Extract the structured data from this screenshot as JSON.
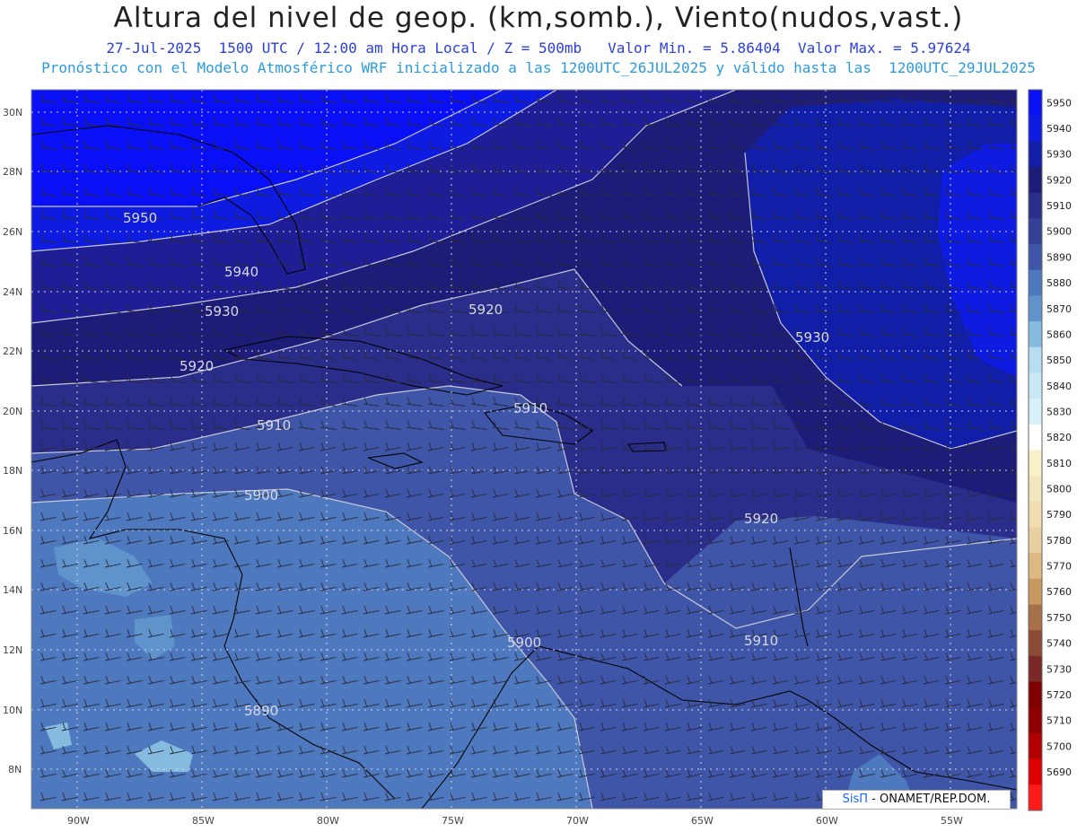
{
  "header": {
    "title": "Altura del nivel de geop. (km,somb.), Viento(nudos,vast.)",
    "line1": "27-Jul-2025  1500 UTC / 12:00 am Hora Local / Z = 500mb   Valor Min. = 5.86404  Valor Max. = 5.97624",
    "line2": "Pronóstico con el Modelo Atmosférico WRF inicializado a las 1200UTC_26JUL2025 y válido hasta las  1200UTC_29JUL2025"
  },
  "map": {
    "lat_labels": [
      "30N",
      "28N",
      "26N",
      "24N",
      "22N",
      "20N",
      "18N",
      "16N",
      "14N",
      "12N",
      "10N",
      "8N"
    ],
    "lon_labels": [
      "90W",
      "85W",
      "80W",
      "75W",
      "70W",
      "65W",
      "60W",
      "55W"
    ],
    "contour_labels": [
      "5950",
      "5940",
      "5930",
      "5920",
      "5920",
      "5930",
      "5910",
      "5910",
      "5900",
      "5920",
      "5910",
      "5900",
      "5890"
    ]
  },
  "colorbar": {
    "levels": [
      "5950",
      "5940",
      "5930",
      "5920",
      "5910",
      "5900",
      "5890",
      "5880",
      "5870",
      "5860",
      "5850",
      "5840",
      "5830",
      "5820",
      "5810",
      "5800",
      "5790",
      "5780",
      "5770",
      "5760",
      "5750",
      "5740",
      "5730",
      "5720",
      "5710",
      "5700",
      "5690"
    ],
    "colors": [
      "#0a10f5",
      "#0e1be0",
      "#101ea8",
      "#1d1c78",
      "#2b2d8a",
      "#343f96",
      "#3e55a8",
      "#4e79bf",
      "#5e93cc",
      "#86bbe0",
      "#b6def0",
      "#c8e8f5",
      "#d8f0f8",
      "#ffffff",
      "#f8f0c8",
      "#f4e6bc",
      "#efdcb0",
      "#e8cfa0",
      "#ddb880",
      "#c79860",
      "#a87048",
      "#8c4a36",
      "#7a2828",
      "#800000",
      "#900000",
      "#b20000",
      "#e00000",
      "#ff1a1a"
    ]
  },
  "credit": {
    "brand": "SisΠ",
    "text": " - ONAMET/REP.DOM."
  }
}
